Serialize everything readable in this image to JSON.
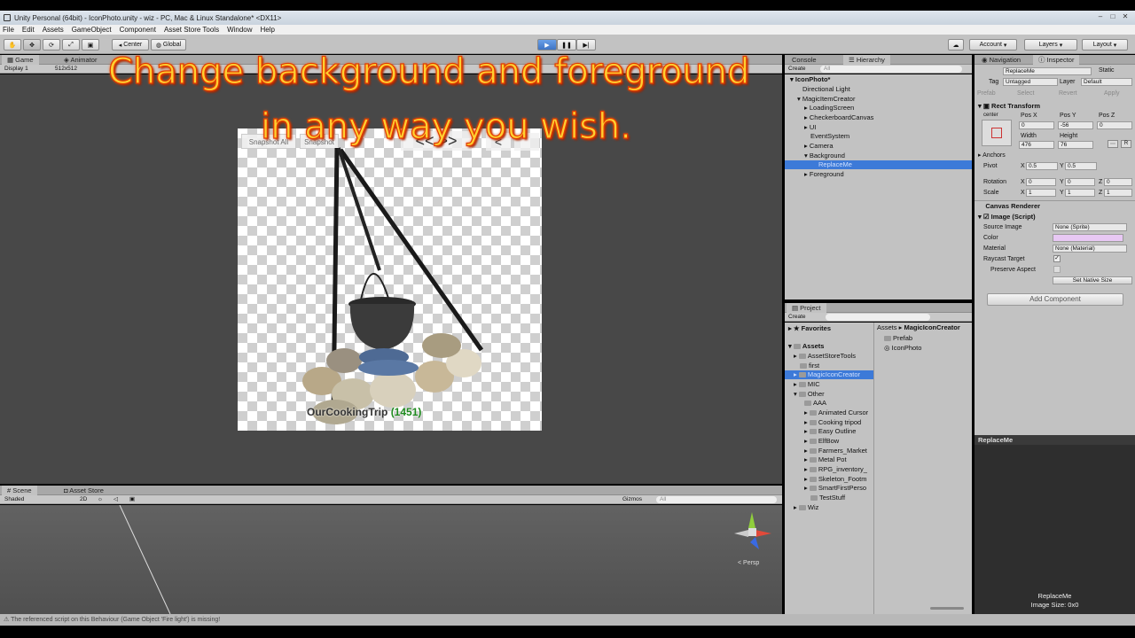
{
  "window": {
    "title": "Unity Personal (64bit) - IconPhoto.unity - wiz - PC, Mac & Linux Standalone* <DX11>"
  },
  "menu": [
    "File",
    "Edit",
    "Assets",
    "GameObject",
    "Component",
    "Asset Store Tools",
    "Window",
    "Help"
  ],
  "toolbar": {
    "center_label": "Center",
    "global_label": "Global",
    "account_label": "Account",
    "layers_label": "Layers",
    "layout_label": "Layout"
  },
  "game": {
    "tabs": [
      "Game",
      "Animator"
    ],
    "display_label": "Display 1",
    "resolution_label": "512x512",
    "snapshot_btn_1": "Snapshot All",
    "snapshot_btn_2": "Snapshot",
    "nav_arrows": "<< >>",
    "nav_arrow_small": "<",
    "item_label": "OurCookingTrip",
    "item_count": "(1451)"
  },
  "overlay": {
    "line1": "Change background and foreground",
    "line2": "in any way you wish."
  },
  "scene": {
    "tabs": [
      "Scene",
      "Asset Store"
    ],
    "shaded_label": "Shaded",
    "twod_label": "2D",
    "gizmos_label": "Gizmos",
    "search_placeholder": "All",
    "persp_label": "< Persp"
  },
  "hierarchy": {
    "tabs": [
      "Console",
      "Hierarchy"
    ],
    "create_label": "Create",
    "search_placeholder": "All",
    "scene_name": "IconPhoto*",
    "items": [
      {
        "label": "Directional Light",
        "indent": 1
      },
      {
        "label": "MagicItemCreator",
        "indent": 1
      },
      {
        "label": "LoadingScreen",
        "indent": 2
      },
      {
        "label": "CheckerboardCanvas",
        "indent": 2
      },
      {
        "label": "UI",
        "indent": 2
      },
      {
        "label": "EventSystem",
        "indent": 2
      },
      {
        "label": "Camera",
        "indent": 2
      },
      {
        "label": "Background",
        "indent": 2
      },
      {
        "label": "ReplaceMe",
        "indent": 3,
        "selected": true
      },
      {
        "label": "Foreground",
        "indent": 2
      }
    ]
  },
  "project": {
    "tab": "Project",
    "create_label": "Create",
    "favorites_label": "Favorites",
    "assets_label": "Assets",
    "folders": [
      "AssetStoreTools",
      "first",
      "MagicIconCreator",
      "MIC",
      "Other",
      "AAA",
      "Animated Cursor",
      "Cooking tripod",
      "Easy Outline",
      "ElfBow",
      "Farmers_Market",
      "Metal Pot",
      "RPG_inventory_",
      "Skeleton_Footm",
      "SmartFirstPerso",
      "TestStuff",
      "Wiz"
    ],
    "breadcrumb": [
      "Assets",
      "MagicIconCreator"
    ],
    "files": [
      "Prefab",
      "IconPhoto"
    ]
  },
  "inspector": {
    "tabs": [
      "Navigation",
      "Inspector"
    ],
    "object_name": "ReplaceMe",
    "static_label": "Static",
    "tag_label": "Tag",
    "tag_value": "Untagged",
    "layer_label": "Layer",
    "layer_value": "Default",
    "prefab_label": "Prefab",
    "select_label": "Select",
    "revert_label": "Revert",
    "apply_label": "Apply",
    "rect_transform": "Rect Transform",
    "center_label": "center",
    "pos_x_label": "Pos X",
    "pos_y_label": "Pos Y",
    "pos_z_label": "Pos Z",
    "pos_x": "0",
    "pos_y": "-56",
    "pos_z": "0",
    "width_label": "Width",
    "height_label": "Height",
    "width": "476",
    "height": "76",
    "anchors_label": "Anchors",
    "pivot_label": "Pivot",
    "pivot_x": "0.5",
    "pivot_y": "0.5",
    "rotation_label": "Rotation",
    "rot_x": "0",
    "rot_y": "0",
    "rot_z": "0",
    "scale_label": "Scale",
    "scale_x": "1",
    "scale_y": "1",
    "scale_z": "1",
    "canvas_renderer": "Canvas Renderer",
    "image_script": "Image (Script)",
    "source_image_label": "Source Image",
    "source_image_value": "None (Sprite)",
    "color_label": "Color",
    "color_value": "#e8c8f4",
    "material_label": "Material",
    "material_value": "None (Material)",
    "raycast_label": "Raycast Target",
    "preserve_label": "Preserve Aspect",
    "set_native_label": "Set Native Size",
    "add_component_label": "Add Component",
    "x_label": "X",
    "y_label": "Y",
    "z_label": "Z"
  },
  "preview": {
    "header": "ReplaceMe",
    "name": "ReplaceMe",
    "size": "Image Size: 0x0"
  },
  "status": {
    "message": "The referenced script on this Behaviour (Game Object 'Fire light') is missing!"
  }
}
